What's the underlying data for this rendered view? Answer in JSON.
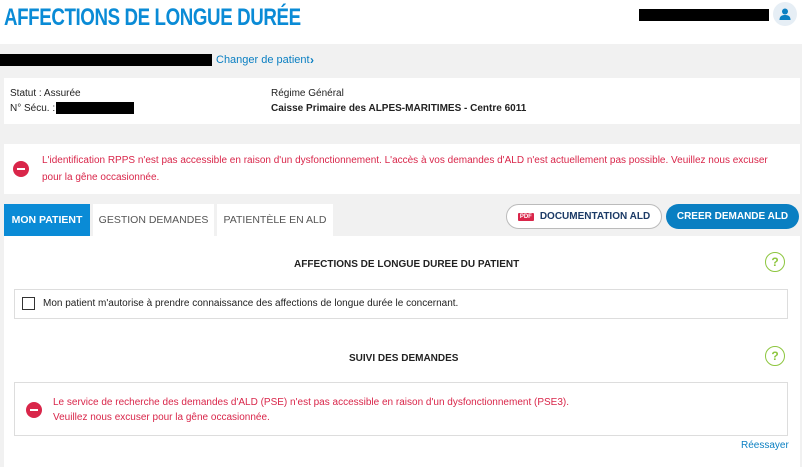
{
  "header": {
    "app_title": "AFFECTIONS DE LONGUE DURÉE",
    "user_icon": "user-icon"
  },
  "patient_bar": {
    "change_patient_label": "Changer de patient",
    "chevron_icon": "chevron-right-icon"
  },
  "patient_info": {
    "status_label": "Statut : Assurée",
    "secu_label": "N° Sécu. :",
    "regime": "Régime Général",
    "caisse": "Caisse Primaire des ALPES-MARITIMES - Centre 6011"
  },
  "alerts": {
    "rpps_line1": "L'identification RPPS n'est pas accessible en raison d'un dysfonctionnement. L'accès à vos demandes d'ALD n'est actuellement pas possible. Veuillez nous excuser",
    "rpps_line2": "pour la gêne occasionnée.",
    "pse_line1": "Le service de recherche des demandes d'ALD (PSE) n'est pas accessible en raison d'un dysfonctionnement (PSE3).",
    "pse_line2": "Veuillez nous excuser pour la gêne occasionnée."
  },
  "tabs": [
    {
      "label": "MON PATIENT"
    },
    {
      "label": "GESTION DEMANDES"
    },
    {
      "label": "PATIENTÈLE EN ALD"
    }
  ],
  "actions": {
    "pdf_badge": "PDF",
    "doc_label": "DOCUMENTATION ALD",
    "create_label": "CREER DEMANDE ALD"
  },
  "sections": {
    "ald_title": "AFFECTIONS DE LONGUE DUREE DU PATIENT",
    "consent_text": "Mon patient m'autorise à prendre connaissance des affections de longue durée le concernant.",
    "suivi_title": "SUIVI DES DEMANDES",
    "help_glyph": "?",
    "retry_label": "Réessayer"
  },
  "colors": {
    "brand_blue": "#0a8bd6",
    "error_red": "#d9264a",
    "help_green": "#8dc63f"
  }
}
